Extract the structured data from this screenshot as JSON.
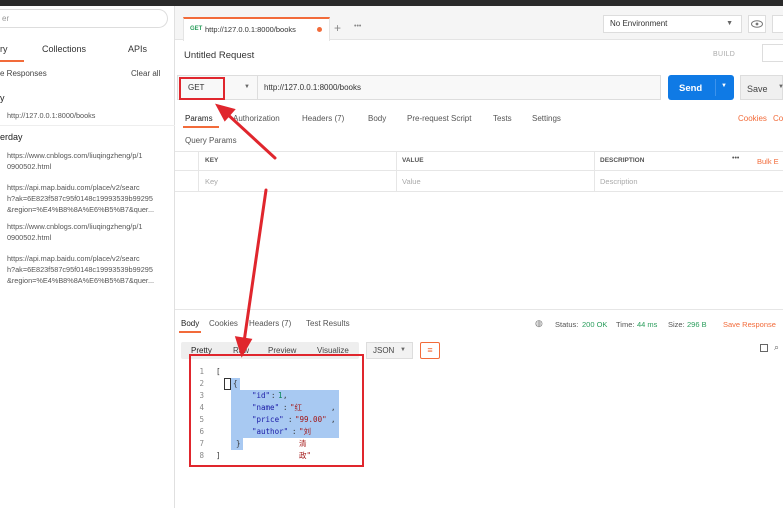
{
  "sidebar": {
    "search_placeholder": "er",
    "tabs": [
      "ry",
      "Collections",
      "APIs"
    ],
    "save_responses": "e Responses",
    "clear_all": "Clear all",
    "groups": [
      {
        "label": "y",
        "items": [
          "http://127.0.0.1:8000/books"
        ]
      },
      {
        "label": "erday",
        "items": [
          "https://www.cnblogs.com/liuqingzheng/p/1\n0900502.html",
          "https://api.map.baidu.com/place/v2/searc\nh?ak=6E823f587c95f0148c19993539b99295\n&region=%E4%B8%8A%E6%B5%B7&quer...",
          "https://www.cnblogs.com/liuqingzheng/p/1\n0900502.html",
          "https://api.map.baidu.com/place/v2/searc\nh?ak=6E823f587c95f0148c19993539b99295\n&region=%E4%B8%8A%E6%B5%B7&quer..."
        ]
      }
    ]
  },
  "tab": {
    "method": "GET",
    "url": "http://127.0.0.1:8000/books",
    "dot_color": "#f26b3a"
  },
  "env": {
    "label": "No Environment"
  },
  "request": {
    "title": "Untitled Request",
    "build": "BUILD",
    "method": "GET",
    "url": "http://127.0.0.1:8000/books",
    "send": "Send",
    "save": "Save"
  },
  "subtabs": [
    "Params",
    "Authorization",
    "Headers (7)",
    "Body",
    "Pre-request Script",
    "Tests",
    "Settings"
  ],
  "cookies_link": "Cookies",
  "code_link": "Co",
  "query_params": {
    "title": "Query Params",
    "headers": [
      "KEY",
      "VALUE",
      "DESCRIPTION"
    ],
    "more": "•••",
    "bulk": "Bulk E",
    "placeholders": [
      "Key",
      "Value",
      "Description"
    ]
  },
  "response": {
    "tabs": [
      "Body",
      "Cookies",
      "Headers (7)",
      "Test Results"
    ],
    "status_label": "Status:",
    "status_value": "200 OK",
    "time_label": "Time:",
    "time_value": "44 ms",
    "size_label": "Size:",
    "size_value": "296 B",
    "save_response": "Save Response",
    "formats": [
      "Pretty",
      "Raw",
      "Preview",
      "Visualize"
    ],
    "format_type": "JSON"
  },
  "code_lines": [
    {
      "n": "1",
      "text": "["
    },
    {
      "n": "2",
      "text": "{"
    },
    {
      "n": "3",
      "key": "\"id\"",
      "val": "1",
      "vtype": "n"
    },
    {
      "n": "4",
      "key": "\"name\"",
      "val": "\"红楼梦\"",
      "vtype": "s"
    },
    {
      "n": "5",
      "key": "\"price\"",
      "val": "\"99.00\"",
      "vtype": "s"
    },
    {
      "n": "6",
      "key": "\"author\"",
      "val": "\"刘清政\"",
      "vtype": "s"
    },
    {
      "n": "7",
      "text": "}"
    },
    {
      "n": "8",
      "text": "]"
    }
  ]
}
